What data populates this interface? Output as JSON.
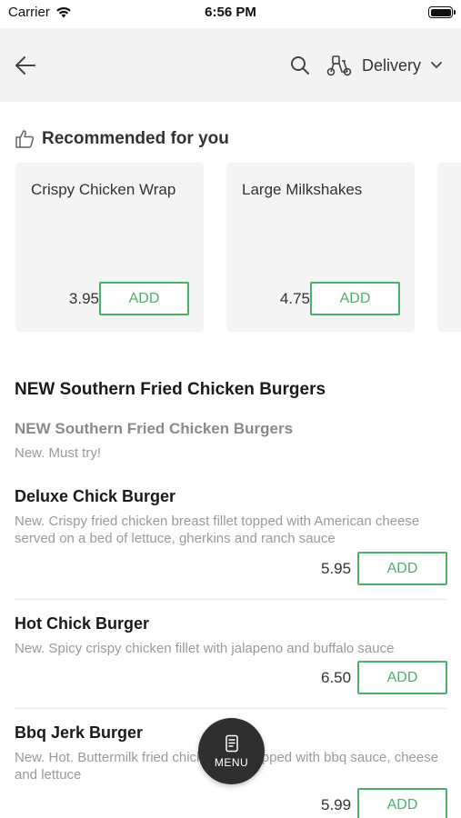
{
  "status_bar": {
    "carrier": "Carrier",
    "time": "6:56 PM"
  },
  "header": {
    "delivery_label": "Delivery",
    "icons": [
      "back-arrow-icon",
      "search-icon",
      "scooter-icon",
      "chevron-down-icon"
    ]
  },
  "recommended": {
    "title": "Recommended for you",
    "items": [
      {
        "name": "Crispy Chicken Wrap",
        "price": "3.95",
        "add_label": "ADD"
      },
      {
        "name": "Large Milkshakes",
        "price": "4.75",
        "add_label": "ADD"
      }
    ]
  },
  "section": {
    "title": "NEW Southern Fried Chicken Burgers",
    "category_title": "NEW Southern Fried Chicken Burgers",
    "category_desc": "New. Must try!"
  },
  "menu_items": [
    {
      "name": "Deluxe Chick Burger",
      "desc": "New. Crispy fried chicken breast fillet topped with American cheese served on a bed of lettuce, gherkins and ranch sauce",
      "price": "5.95",
      "add_label": "ADD"
    },
    {
      "name": "Hot Chick Burger",
      "desc": "New. Spicy crispy chicken fillet with jalapeno and buffalo sauce",
      "price": "6.50",
      "add_label": "ADD"
    },
    {
      "name": "Bbq Jerk Burger",
      "desc": "New. Hot. Buttermilk fried chicken fillet topped with bbq sauce, cheese and lettuce",
      "price": "5.99",
      "add_label": "ADD"
    }
  ],
  "fab": {
    "label": "MENU"
  },
  "colors": {
    "accent": "#4caf6a",
    "header_bg": "#f3f3f3",
    "card_bg": "#f4f4f4",
    "fab_bg": "#2f2f2f"
  }
}
